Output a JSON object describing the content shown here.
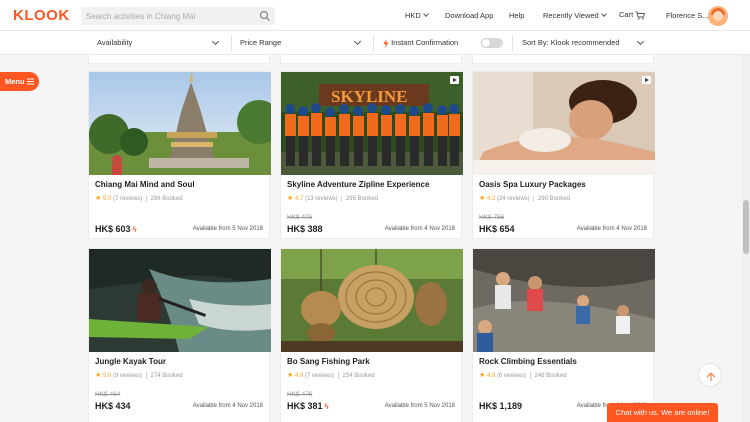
{
  "header": {
    "logo": "KLOOK",
    "search_placeholder": "Search activities in Chiang Mai",
    "currency": "HKD",
    "download_app": "Download App",
    "help": "Help",
    "recently_viewed": "Recently Viewed",
    "cart": "Cart",
    "user": "Florence S..."
  },
  "filters": {
    "availability": "Availability",
    "price_range": "Price Range",
    "instant_confirmation": "Instant Confirmation",
    "sort": "Sort By: Klook recommended",
    "instant_toggle_on": false
  },
  "menu_label": "Menu",
  "cards": [
    {
      "title": "Chiang Mai Mind and Soul",
      "rating": "5.0",
      "reviews": "(7 reviews)",
      "booked": "296 Booked",
      "old_price": "",
      "price": "HK$ 603",
      "instant": true,
      "available": "Available from 5 Nov 2018",
      "video": false
    },
    {
      "title": "Skyline Adventure Zipline Experience",
      "rating": "4.7",
      "reviews": "(13 reviews)",
      "booked": "295 Booked",
      "old_price": "HK$ 476",
      "price": "HK$ 388",
      "instant": false,
      "available": "Available from 4 Nov 2018",
      "video": true
    },
    {
      "title": "Oasis Spa Luxury Packages",
      "rating": "4.2",
      "reviews": "(24 reviews)",
      "booked": "290 Booked",
      "old_price": "HK$ 756",
      "price": "HK$ 654",
      "instant": false,
      "available": "Available from 4 Nov 2018",
      "video": true
    },
    {
      "title": "Jungle Kayak Tour",
      "rating": "5.0",
      "reviews": "(9 reviews)",
      "booked": "274 Booked",
      "old_price": "HK$ 464",
      "price": "HK$ 434",
      "instant": false,
      "available": "Available from 4 Nov 2018",
      "video": false
    },
    {
      "title": "Bo Sang Fishing Park",
      "rating": "4.9",
      "reviews": "(7 reviews)",
      "booked": "254 Booked",
      "old_price": "HK$ 476",
      "price": "HK$ 381",
      "instant": true,
      "available": "Available from 5 Nov 2018",
      "video": false
    },
    {
      "title": "Rock Climbing Essentials",
      "rating": "4.8",
      "reviews": "(6 reviews)",
      "booked": "248 Booked",
      "old_price": "",
      "price": "HK$ 1,189",
      "instant": false,
      "available": "Available from 4 Nov 2018",
      "video": false
    }
  ],
  "chat_label": "Chat with us. We are online!",
  "colors": {
    "brand": "#ff5722",
    "star": "#ffa31a"
  }
}
